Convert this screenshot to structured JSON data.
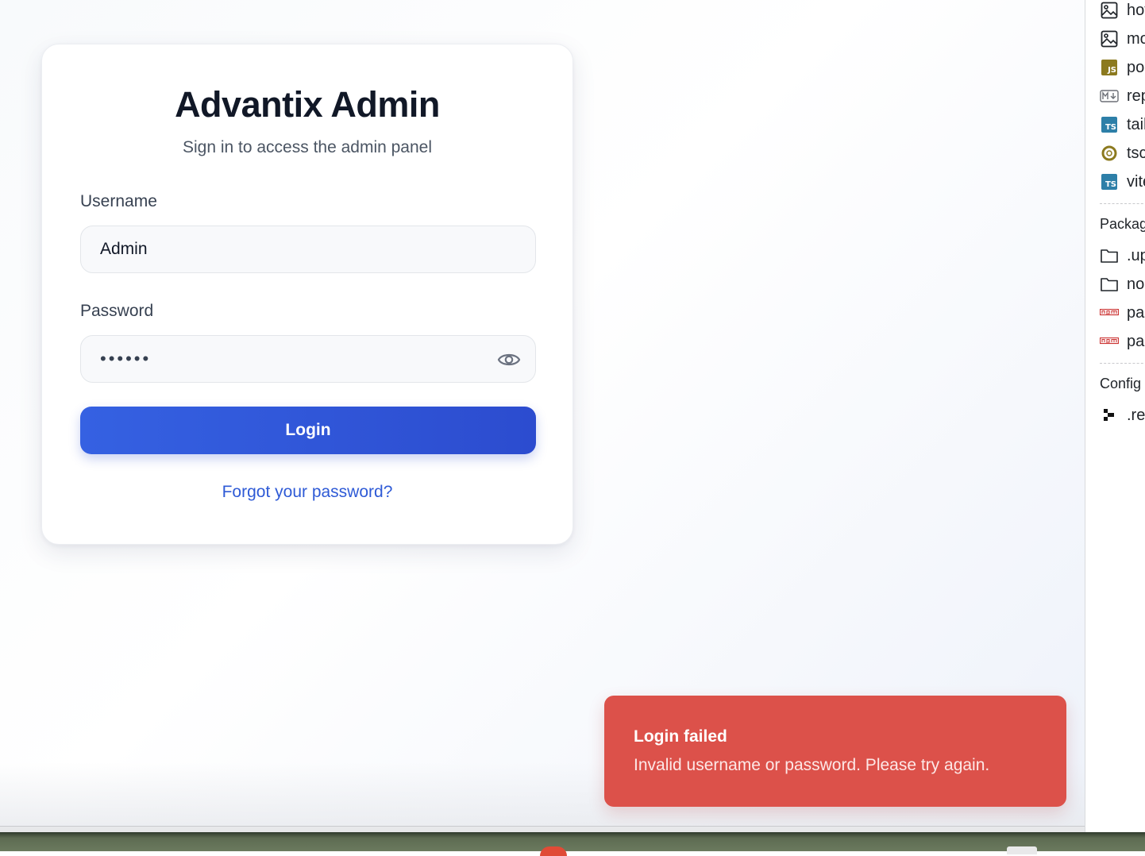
{
  "login": {
    "title": "Advantix Admin",
    "subtitle": "Sign in to access the admin panel",
    "username_label": "Username",
    "username_value": "Admin",
    "password_label": "Password",
    "password_masked": "••••••",
    "login_label": "Login",
    "forgot_label": "Forgot your password?"
  },
  "toast": {
    "title": "Login failed",
    "message": "Invalid username or password. Please try again.",
    "color": "#dc514a"
  },
  "explorer": {
    "top_files": [
      {
        "icon": "image-file-icon",
        "label": "hov"
      },
      {
        "icon": "image-file-icon",
        "label": "mo"
      },
      {
        "icon": "js-file-icon",
        "label": "pos"
      },
      {
        "icon": "markdown-file-icon",
        "label": "rep"
      },
      {
        "icon": "ts-file-icon",
        "label": "tail"
      },
      {
        "icon": "tsconfig-file-icon",
        "label": "tsc"
      },
      {
        "icon": "ts-file-icon",
        "label": "vite"
      }
    ],
    "packages_label": "Packag",
    "package_items": [
      {
        "icon": "folder-icon",
        "label": ".up"
      },
      {
        "icon": "folder-icon",
        "label": "noc"
      },
      {
        "icon": "npm-file-icon",
        "label": "pac"
      },
      {
        "icon": "npm-file-icon",
        "label": "pac"
      }
    ],
    "config_label": "Config f",
    "config_items": [
      {
        "icon": "config-file-icon",
        "label": ".re"
      }
    ]
  },
  "colors": {
    "primary": "#2f55d9",
    "link": "#2e5ad6",
    "error": "#dc514a"
  }
}
